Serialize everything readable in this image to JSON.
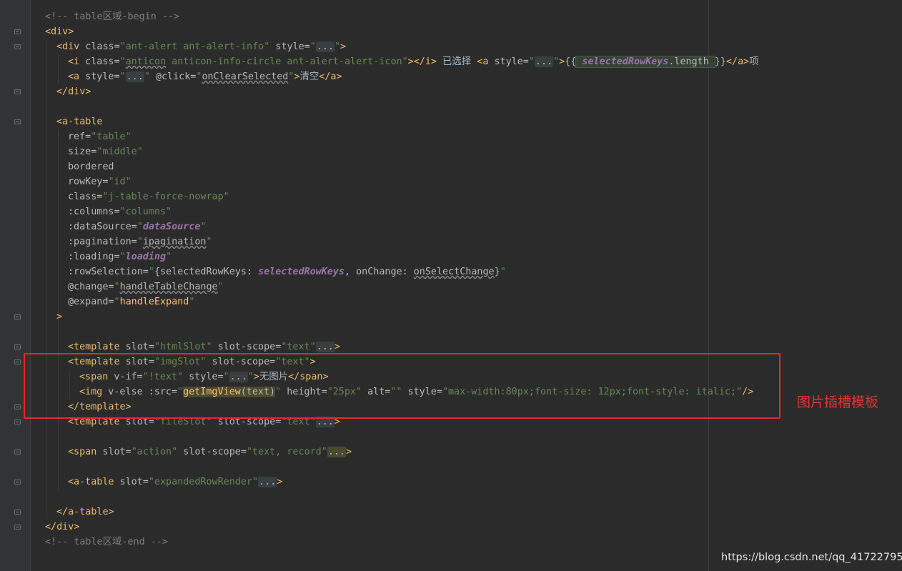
{
  "code": {
    "l1": {
      "comment": "<!-- table区域-begin -->"
    },
    "l2": {
      "open": "<div>"
    },
    "l3": {
      "open": "<div",
      "attr": " class=",
      "class_val": "\"ant-alert ant-alert-info\"",
      "style_attr": " style=",
      "q1": "\"",
      "fold": "...",
      "q2": "\"",
      "close": ">"
    },
    "l4": {
      "open": "<i",
      "attr": " class=",
      "q1": "\"",
      "v1": "anticon",
      "v2": " anticon-info-circle ant-alert-alert-icon",
      "q2": "\"",
      "close": "></i>",
      "text1": " 已选择 ",
      "a_open": "<a",
      "style_attr": " style=",
      "q3": "\"",
      "fold": "...",
      "q4": "\"",
      "gt": ">",
      "mus_open": "{{",
      "expr_var": " selectedRowKeys",
      "expr_prop": ".length ",
      "mus_close": "}}",
      "a_close": "</a>",
      "text2": "项"
    },
    "l5": {
      "open": "<a",
      "style_attr": " style=",
      "q1": "\"",
      "fold": "...",
      "q2": "\"",
      "click_attr": " @click=",
      "q3": "\"",
      "handler": "onClearSelected",
      "q4": "\"",
      "gt": ">",
      "text": "清空",
      "close": "</a>"
    },
    "l6": {
      "close": "</div>"
    },
    "l8": {
      "open": "<a-table"
    },
    "l9": {
      "attr": "ref=",
      "val": "\"table\""
    },
    "l10": {
      "attr": "size=",
      "val": "\"middle\""
    },
    "l11": {
      "attr": "bordered"
    },
    "l12": {
      "attr": "rowKey=",
      "val": "\"id\""
    },
    "l13": {
      "attr": "class=",
      "val": "\"j-table-force-nowrap\""
    },
    "l14": {
      "attr": ":columns=",
      "val": "\"columns\""
    },
    "l15": {
      "attr": ":dataSource=",
      "q1": "\"",
      "var": "dataSource",
      "q2": "\""
    },
    "l16": {
      "attr": ":pagination=",
      "q1": "\"",
      "var": "ipagination",
      "q2": "\""
    },
    "l17": {
      "attr": ":loading=",
      "q1": "\"",
      "var": "loading",
      "q2": "\""
    },
    "l18": {
      "attr": ":rowSelection=",
      "q1": "\"",
      "p1": "{selectedRowKeys: ",
      "v1": "selectedRowKeys",
      "p2": ", onChange: ",
      "v2": "onSelectChange",
      "p3": "}",
      "q2": "\""
    },
    "l19": {
      "attr": "@change=",
      "q1": "\"",
      "handler": "handleTableChange",
      "q2": "\""
    },
    "l20": {
      "attr": "@expand=",
      "q1": "\"",
      "handler": "handleExpand",
      "q2": "\""
    },
    "l21": {
      "close": ">"
    },
    "l23": {
      "open": "<template",
      "attr1": " slot=",
      "v1": "\"htmlSlot\"",
      "attr2": " slot-scope=",
      "v2": "\"text\"",
      "fold": "...",
      "close": ">"
    },
    "l24": {
      "open": "<template",
      "attr1": " slot=",
      "v1": "\"imgSlot\"",
      "attr2": " slot-scope=",
      "v2": "\"text\"",
      "close": ">"
    },
    "l25": {
      "open": "<span",
      "attr1": " v-if=",
      "v1": "\"!text\"",
      "attr2": " style=",
      "q1": "\"",
      "fold": "...",
      "q2": "\"",
      "gt": ">",
      "text": "无图片",
      "close": "</span>"
    },
    "l26": {
      "open": "<img",
      "attr1": " v-else :src=",
      "q1": "\"",
      "fn": "getImgView",
      "args": "(text)",
      "q2": "\"",
      "attr2": " height=",
      "v2": "\"25px\"",
      "attr3": " alt=",
      "v3": "\"\"",
      "attr4": " style=",
      "v4": "\"max-width:80px;font-size: 12px;font-style: italic;\"",
      "close": "/>"
    },
    "l27": {
      "close": "</template>"
    },
    "l28": {
      "open": "<template",
      "attr1": " slot=",
      "v1": "\"fileSlot\"",
      "attr2": " slot-scope=",
      "v2": "\"text\"",
      "fold": "...",
      "close": ">"
    },
    "l30": {
      "open": "<span",
      "attr1": " slot=",
      "v1": "\"action\"",
      "attr2": " slot-scope=",
      "v2": "\"text, record\"",
      "fold": "...",
      "close": ">"
    },
    "l32": {
      "open": "<a-table",
      "attr1": " slot=",
      "v1": "\"expandedRowRender\"",
      "fold": "...",
      "close": ">"
    },
    "l34": {
      "close": "</a-table>"
    },
    "l35": {
      "close": "</div>"
    },
    "l36": {
      "comment": "<!-- table区域-end -->"
    }
  },
  "annotation": "图片插槽模板",
  "watermark": "https://blog.csdn.net/qq_41722795",
  "colors": {
    "background": "#2b2b2b",
    "tag": "#e8bf6a",
    "attribute": "#bababa",
    "string": "#6a8759",
    "comment": "#808080",
    "variable": "#9876aa",
    "function": "#ffc66d",
    "highlight_box": "#e02b2b"
  }
}
